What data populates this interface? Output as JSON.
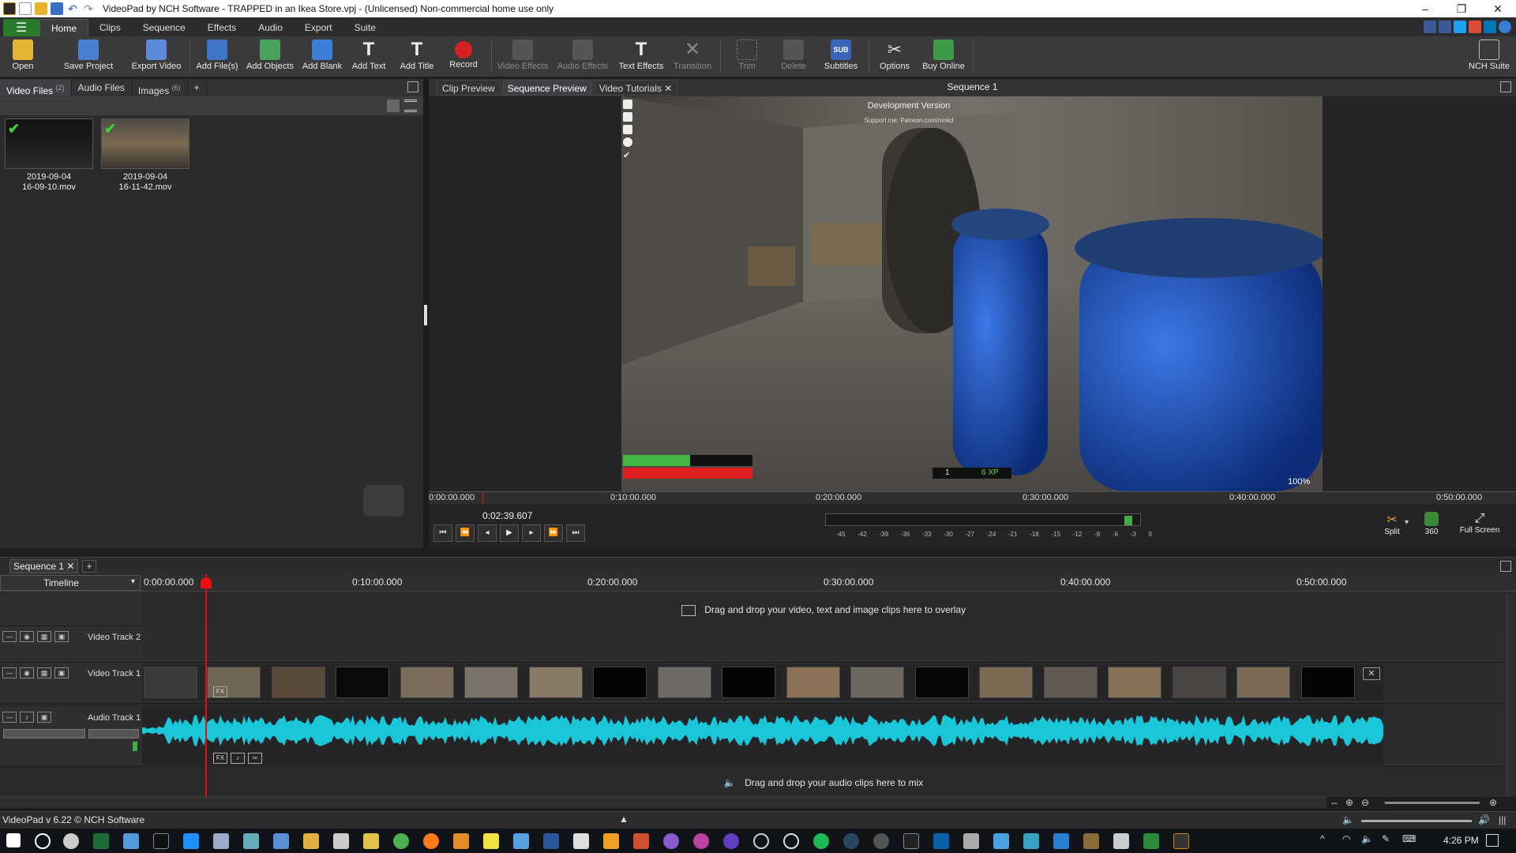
{
  "window": {
    "title": "VideoPad by NCH Software - TRAPPED in an Ikea Store.vpj - (Unlicensed) Non-commercial home use only",
    "controls": [
      "–",
      "❐",
      "✕"
    ]
  },
  "menu": {
    "tabs": [
      "Home",
      "Clips",
      "Sequence",
      "Effects",
      "Audio",
      "Export",
      "Suite"
    ],
    "active": "Home"
  },
  "toolbar": {
    "open": "Open",
    "save_project": "Save Project",
    "export_video": "Export Video",
    "add_files": "Add File(s)",
    "add_objects": "Add Objects",
    "add_blank": "Add Blank",
    "add_text": "Add Text",
    "add_title": "Add Title",
    "record": "Record",
    "video_effects": "Video Effects",
    "audio_effects": "Audio Effects",
    "text_effects": "Text Effects",
    "transition": "Transition",
    "trim": "Trim",
    "delete": "Delete",
    "subtitles": "Subtitles",
    "options": "Options",
    "buy_online": "Buy Online",
    "nch_suite": "NCH Suite"
  },
  "media": {
    "tabs": [
      {
        "label": "Video Files",
        "count": "(2)"
      },
      {
        "label": "Audio Files",
        "count": ""
      },
      {
        "label": "Images",
        "count": "(6)"
      },
      {
        "label": "+",
        "count": ""
      }
    ],
    "files": [
      {
        "line1": "2019-09-04",
        "line2": "16-09-10.mov"
      },
      {
        "line1": "2019-09-04",
        "line2": "16-11-42.mov"
      }
    ]
  },
  "preview": {
    "tabs": [
      "Clip Preview",
      "Sequence Preview",
      "Video Tutorials"
    ],
    "active": "Sequence Preview",
    "sequence_title": "Sequence 1",
    "overlay_title": "Development Version",
    "overlay_sub": "Support me: Patreon.com/nmkd",
    "hud_count": "1",
    "hud_xp": "6 XP",
    "zoom": "100%",
    "scrub_ticks": [
      "0:00:00.000",
      "0:10:00.000",
      "0:20:00.000",
      "0:30:00.000",
      "0:40:00.000",
      "0:50:00.000"
    ],
    "current_time": "0:02:39.607",
    "meter_ticks": [
      "-45",
      "-42",
      "-39",
      "-36",
      "-33",
      "-30",
      "-27",
      "-24",
      "-21",
      "-18",
      "-15",
      "-12",
      "-9",
      "-6",
      "-3",
      "0"
    ],
    "split": "Split",
    "vr": "360",
    "full_screen": "Full Screen"
  },
  "sequence": {
    "tab": "Sequence 1",
    "mode": "Timeline",
    "ticks": [
      "0:00:00.000",
      "0:10:00.000",
      "0:20:00.000",
      "0:30:00.000",
      "0:40:00.000",
      "0:50:00.000"
    ],
    "overlay_hint": "Drag and drop your video, text and image clips here to overlay",
    "video_track_2": "Video Track 2",
    "video_track_1": "Video Track 1",
    "audio_track_1": "Audio Track 1",
    "audio_hint": "Drag and drop your audio clips here to mix"
  },
  "status": {
    "version": "VideoPad v 6.22 © NCH Software"
  },
  "taskbar": {
    "time": "4:26 PM"
  }
}
